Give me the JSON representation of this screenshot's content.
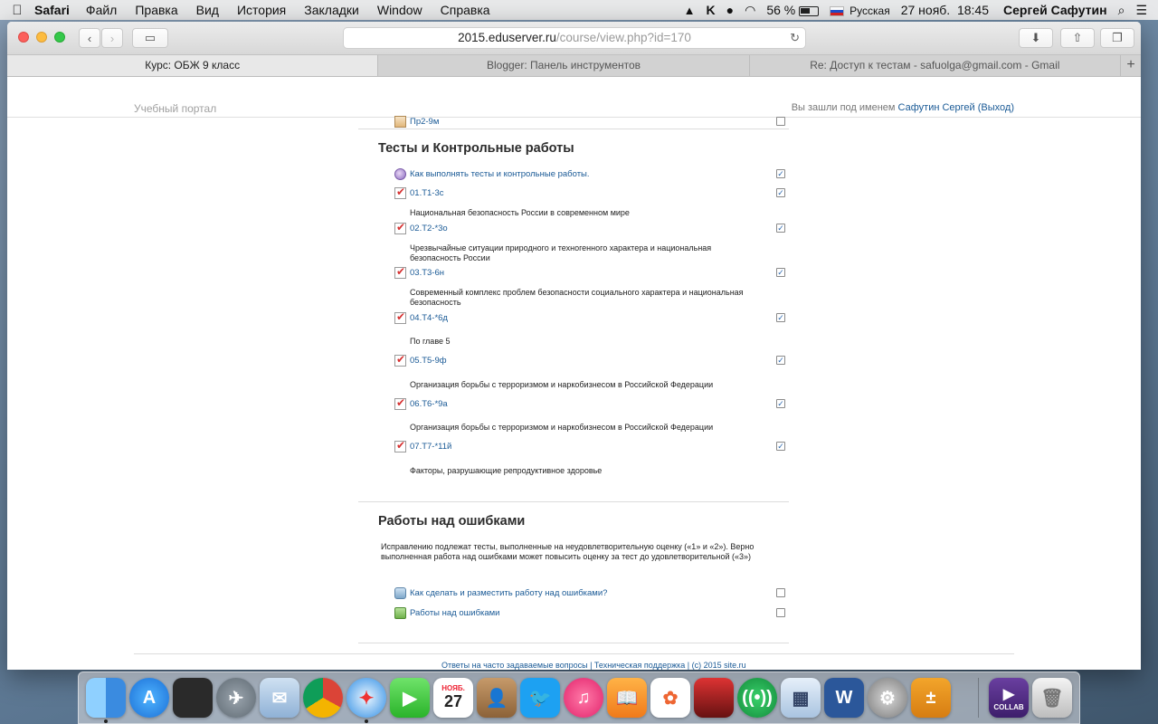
{
  "menubar": {
    "app_name": "Safari",
    "items": [
      "Файл",
      "Правка",
      "Вид",
      "История",
      "Закладки",
      "Window",
      "Справка"
    ],
    "battery": "56 %",
    "input_source": "Русская",
    "date": "27 нояб.",
    "time": "18:45",
    "user": "Сергей Сафутин"
  },
  "browser": {
    "url_host": "2015.eduserver.ru",
    "url_path": "/course/view.php?id=170",
    "tabs": [
      {
        "label": "Курс: ОБЖ 9 класс",
        "active": true
      },
      {
        "label": "Blogger: Панель инструментов",
        "active": false
      },
      {
        "label": "Re: Доступ к тестам - safuolga@gmail.com - Gmail",
        "active": false
      }
    ]
  },
  "portal": {
    "name": "Учебный портал",
    "login_prefix": "Вы зашли под именем",
    "user_link": "Сафутин Сергей",
    "logout": "(Выход)"
  },
  "prev_item": {
    "label": "Пр2-9м",
    "checked": false
  },
  "sections": {
    "tests": {
      "title": "Тесты и Контрольные работы",
      "howto": {
        "label": "Как выполнять тесты и контрольные работы.",
        "checked": true
      },
      "items": [
        {
          "label": "01.Т1-3с",
          "desc": "Национальная безопасность России в современном мире",
          "checked": true
        },
        {
          "label": "02.Т2-*3о",
          "desc": "Чрезвычайные ситуации природного и техногенного характера и национальная безопасность России",
          "checked": true
        },
        {
          "label": "03.Т3-6н",
          "desc": "Современный комплекс проблем безопасности социального характера и национальная безопасность",
          "checked": true
        },
        {
          "label": "04.Т4-*6д",
          "desc": "По главе 5",
          "checked": true
        },
        {
          "label": "05.Т5-9ф",
          "desc": "Организация борьбы с терроризмом и наркобизнесом в Российской Федерации",
          "checked": true
        },
        {
          "label": "06.Т6-*9а",
          "desc": "Организация борьбы с терроризмом и наркобизнесом в Российской Федерации",
          "checked": true
        },
        {
          "label": "07.Т7-*11й",
          "desc": "Факторы, разрушающие репродуктивное здоровье",
          "checked": true
        }
      ]
    },
    "errors": {
      "title": "Работы над ошибками",
      "intro": "Исправлению подлежат тесты, выполненные на неудовлетворительную оценку («1» и «2»). Верно выполненная работа над ошибками может повысить оценку за тест до удовлетворительной («3»)",
      "items": [
        {
          "label": "Как сделать и разместить работу над ошибками?",
          "checked": false
        },
        {
          "label": "Работы над ошибками",
          "checked": false
        }
      ]
    }
  },
  "footer": "Ответы на часто задаваемые вопросы | Техническая поддержка | (c) 2015 site.ru",
  "dock": {
    "calendar_month": "НОЯБ.",
    "calendar_day": "27",
    "collab_label": "COLLAB"
  }
}
